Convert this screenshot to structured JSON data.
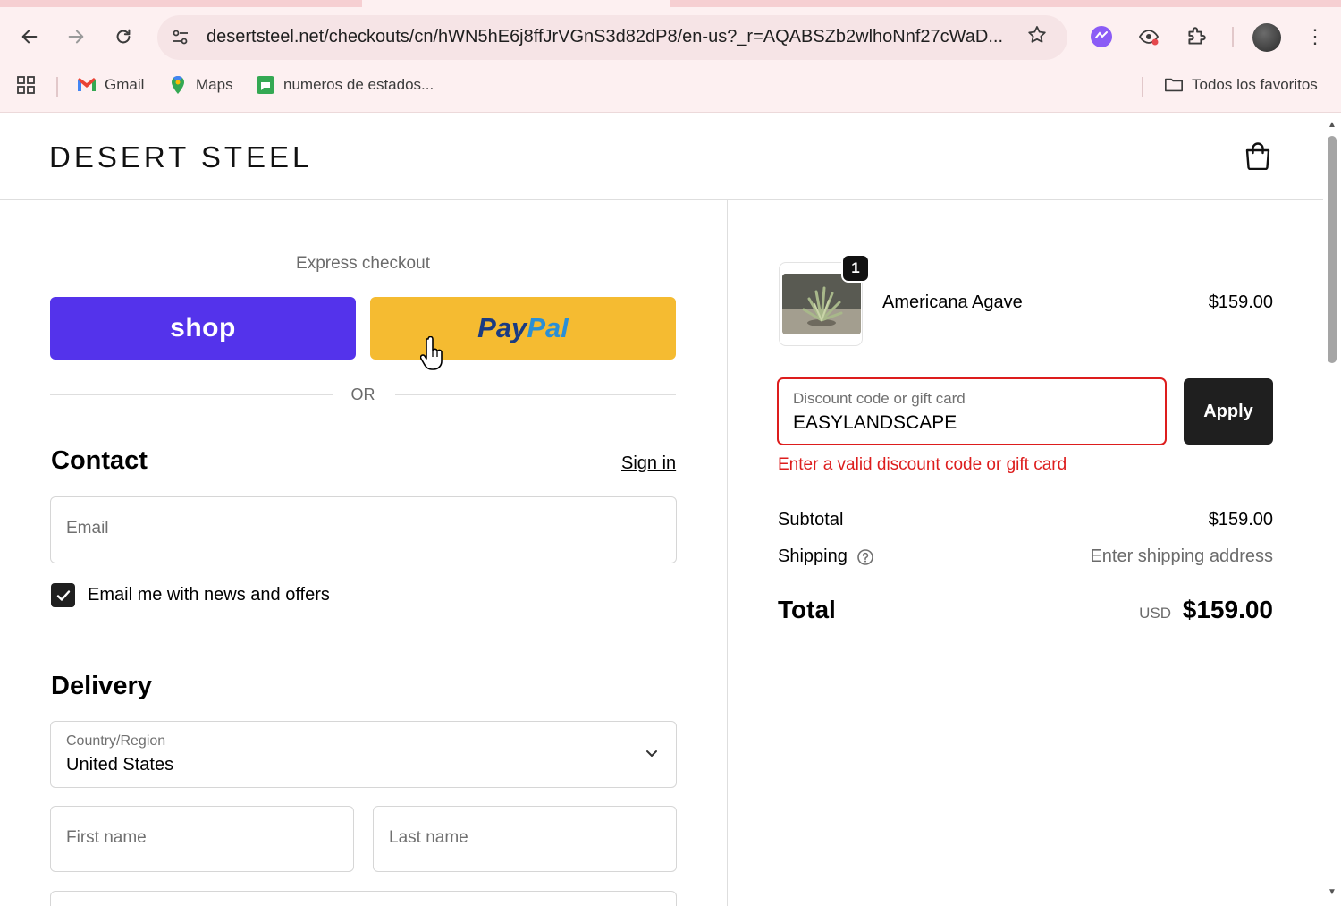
{
  "browser": {
    "url": "desertsteel.net/checkouts/cn/hWN5hE6j8ffJrVGnS3d82dP8/en-us?_r=AQABSZb2wlhoNnf27cWaD...",
    "bookmarks": [
      {
        "label": "Gmail",
        "icon": "gmail-icon"
      },
      {
        "label": "Maps",
        "icon": "maps-icon"
      },
      {
        "label": "numeros de estados...",
        "icon": "sheet-icon"
      }
    ],
    "all_bookmarks_label": "Todos los favoritos"
  },
  "store": {
    "logo": "DESERT STEEL"
  },
  "checkout": {
    "express_label": "Express checkout",
    "shop_label": "shop",
    "paypal_pay": "Pay",
    "paypal_pal": "Pal",
    "or_label": "OR",
    "contact": {
      "title": "Contact",
      "signin_label": "Sign in",
      "email_placeholder": "Email",
      "news_label": "Email me with news and offers",
      "news_checked": true
    },
    "delivery": {
      "title": "Delivery",
      "country_label": "Country/Region",
      "country_value": "United States",
      "first_name_placeholder": "First name",
      "last_name_placeholder": "Last name"
    }
  },
  "summary": {
    "product": {
      "name": "Americana Agave",
      "price": "$159.00",
      "quantity": "1"
    },
    "discount": {
      "label": "Discount code or gift card",
      "value": "EASYLANDSCAPE",
      "apply_label": "Apply",
      "error": "Enter a valid discount code or gift card"
    },
    "subtotal_label": "Subtotal",
    "subtotal_value": "$159.00",
    "shipping_label": "Shipping",
    "shipping_value": "Enter shipping address",
    "total_label": "Total",
    "currency": "USD",
    "total_value": "$159.00"
  },
  "colors": {
    "shop_purple": "#5433eb",
    "paypal_yellow": "#f5bb31",
    "error_red": "#dd1d1d",
    "button_dark": "#1f1f1f"
  }
}
